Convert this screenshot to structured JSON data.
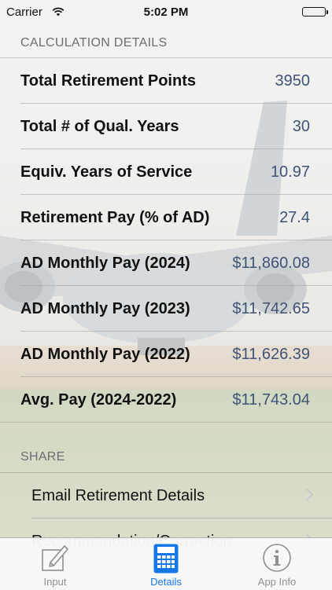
{
  "status_bar": {
    "carrier": "Carrier",
    "time": "5:02 PM",
    "wifi_icon": "wifi-icon",
    "battery_icon": "battery-icon"
  },
  "calculation": {
    "header": "CALCULATION DETAILS",
    "rows": [
      {
        "label": "Total Retirement Points",
        "value": "3950"
      },
      {
        "label": "Total # of Qual. Years",
        "value": "30"
      },
      {
        "label": "Equiv. Years of Service",
        "value": "10.97"
      },
      {
        "label": "Retirement Pay (% of AD)",
        "value": "27.4"
      },
      {
        "label": "AD Monthly Pay (2024)",
        "value": "$11,860.08"
      },
      {
        "label": "AD Monthly Pay (2023)",
        "value": "$11,742.65"
      },
      {
        "label": "AD Monthly Pay (2022)",
        "value": "$11,626.39"
      },
      {
        "label": "Avg. Pay (2024-2022)",
        "value": "$11,743.04"
      }
    ]
  },
  "share": {
    "header": "SHARE",
    "items": [
      {
        "label": "Email Retirement Details"
      },
      {
        "label": "Recommendation/Correction"
      }
    ]
  },
  "tabbar": {
    "tabs": [
      {
        "label": "Input",
        "icon": "edit-icon",
        "active": false
      },
      {
        "label": "Details",
        "icon": "calculator-icon",
        "active": true
      },
      {
        "label": "App Info",
        "icon": "info-icon",
        "active": false
      }
    ]
  },
  "colors": {
    "value_text": "#3f5376",
    "tab_active": "#1577e8",
    "tab_inactive": "#8e8e93",
    "header_text": "#6d6d72"
  }
}
